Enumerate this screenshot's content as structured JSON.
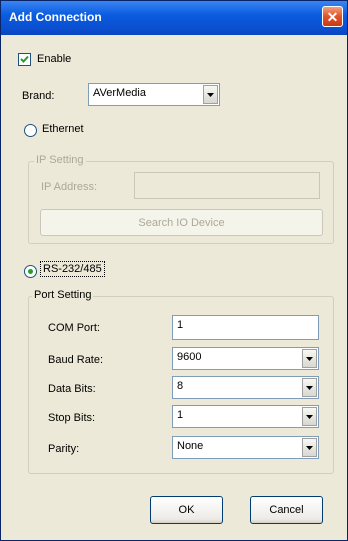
{
  "window": {
    "title": "Add Connection",
    "close_glyph": "✕"
  },
  "enable": {
    "label": "Enable",
    "checked": true
  },
  "brand": {
    "label": "Brand:",
    "value": "AVerMedia"
  },
  "ethernet": {
    "label": "Ethernet",
    "selected": false,
    "group_label": "IP Setting",
    "ip_label": "IP Address:",
    "ip_value": "",
    "search_button": "Search IO Device"
  },
  "rs232": {
    "label": "RS-232/485",
    "selected": true,
    "group_label": "Port Setting",
    "com_port_label": "COM Port:",
    "com_port_value": "1",
    "baud_rate_label": "Baud Rate:",
    "baud_rate_value": "9600",
    "data_bits_label": "Data Bits:",
    "data_bits_value": "8",
    "stop_bits_label": "Stop Bits:",
    "stop_bits_value": "1",
    "parity_label": "Parity:",
    "parity_value": "None"
  },
  "buttons": {
    "ok": "OK",
    "cancel": "Cancel"
  },
  "colors": {
    "titlebar": "#0a4fd0",
    "dialog_bg": "#ece9d8",
    "radio_dot": "#21a121",
    "close_button": "#e0532a"
  }
}
